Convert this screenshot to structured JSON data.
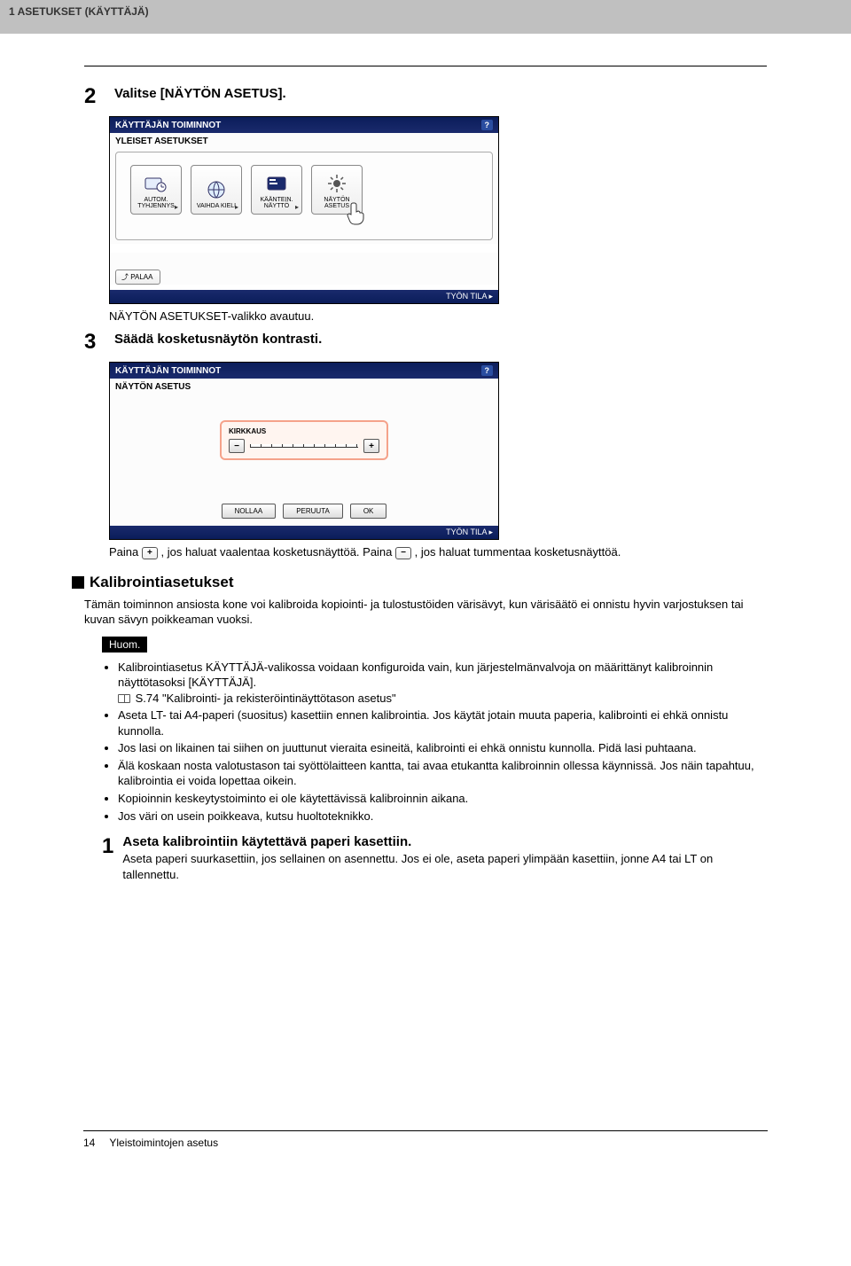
{
  "header": {
    "breadcrumb": "1 ASETUKSET (KÄYTTÄJÄ)"
  },
  "steps": {
    "s2": {
      "num": "2",
      "title": "Valitse [NÄYTÖN ASETUS].",
      "result": "NÄYTÖN ASETUKSET-valikko avautuu."
    },
    "s3": {
      "num": "3",
      "title": "Säädä kosketusnäytön kontrasti."
    }
  },
  "device1": {
    "titlebar": "KÄYTTÄJÄN TOIMINNOT",
    "help": "?",
    "subtitle": "YLEISET ASETUKSET",
    "btn1": "AUTOM. TYHJENNYS",
    "btn2": "VAIHDA KIELI",
    "btn3": "KÄÄNTEIN. NÄYTTÖ",
    "btn4": "NÄYTÖN ASETUS",
    "back": "PALAA",
    "status": "TYÖN TILA ▸"
  },
  "device2": {
    "titlebar": "KÄYTTÄJÄN TOIMINNOT",
    "help": "?",
    "subtitle": "NÄYTÖN ASETUS",
    "contrast_label": "KIRKKAUS",
    "minus": "−",
    "plus": "+",
    "nollaa": "NOLLAA",
    "peruuta": "PERUUTA",
    "ok": "OK",
    "status": "TYÖN TILA ▸"
  },
  "pressline": {
    "prefix": "Paina ",
    "plus": "+",
    "mid1": ", jos haluat vaalentaa kosketusnäyttöä. Paina ",
    "minus": "−",
    "mid2": ", jos haluat tummentaa kosketusnäyttöä."
  },
  "calib": {
    "heading": "Kalibrointiasetukset",
    "intro": "Tämän toiminnon ansiosta kone voi kalibroida kopiointi- ja tulostustöiden värisävyt, kun värisäätö ei onnistu hyvin varjostuksen tai kuvan sävyn poikkeaman vuoksi.",
    "huom": "Huom.",
    "n1a": "Kalibrointiasetus KÄYTTÄJÄ-valikossa voidaan konfiguroida vain, kun järjestelmänvalvoja on määrittänyt kalibroinnin näyttötasoksi [KÄYTTÄJÄ].",
    "n1b": "S.74 \"Kalibrointi- ja rekisteröintinäyttötason asetus\"",
    "n2": "Aseta LT- tai A4-paperi (suositus) kasettiin ennen kalibrointia.  Jos käytät jotain muuta paperia, kalibrointi ei ehkä onnistu kunnolla.",
    "n3": "Jos lasi on likainen tai siihen on juuttunut vieraita esineitä, kalibrointi ei ehkä onnistu kunnolla. Pidä lasi puhtaana.",
    "n4": "Älä koskaan nosta valotustason tai syöttölaitteen kantta, tai avaa etukantta kalibroinnin ollessa käynnissä. Jos näin tapahtuu, kalibrointia ei voida lopettaa oikein.",
    "n5": "Kopioinnin keskeytystoiminto ei ole käytettävissä kalibroinnin aikana.",
    "n6": "Jos väri on usein poikkeava, kutsu huoltoteknikko."
  },
  "step1": {
    "num": "1",
    "title": "Aseta kalibrointiin käytettävä paperi kasettiin.",
    "sub": "Aseta paperi suurkasettiin, jos sellainen on asennettu. Jos ei ole, aseta paperi ylimpään kasettiin, jonne A4 tai LT on tallennettu."
  },
  "footer": {
    "page": "14",
    "section": "Yleistoimintojen asetus"
  }
}
